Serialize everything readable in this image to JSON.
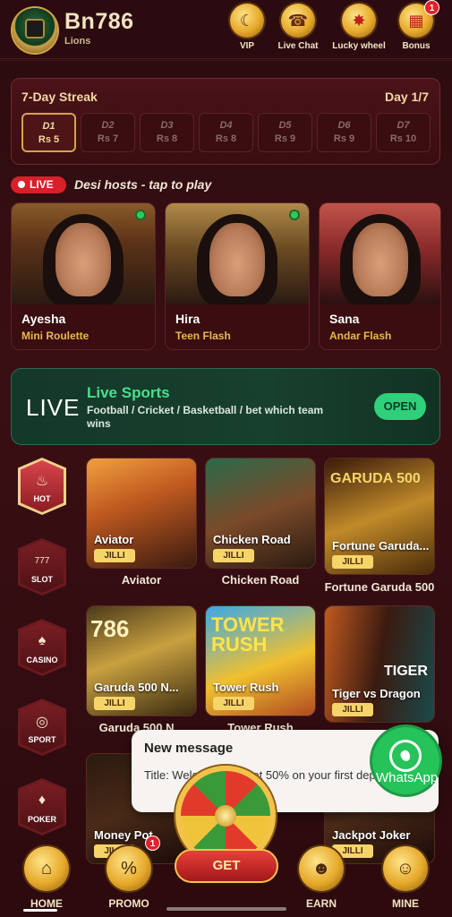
{
  "header": {
    "brand": "Bn786",
    "subtitle": "Lions",
    "buttons": [
      {
        "label": "VIP",
        "icon": "crescent-icon"
      },
      {
        "label": "Live Chat",
        "icon": "headset-icon"
      },
      {
        "label": "Lucky wheel",
        "icon": "wheel-icon"
      },
      {
        "label": "Bonus",
        "icon": "gift-icon",
        "badge": "1"
      }
    ]
  },
  "streak": {
    "title": "7-Day Streak",
    "day": "Day 1/7",
    "days": [
      {
        "d": "D1",
        "reward": "Rs 5"
      },
      {
        "d": "D2",
        "reward": "Rs 7"
      },
      {
        "d": "D3",
        "reward": "Rs 8"
      },
      {
        "d": "D4",
        "reward": "Rs 8"
      },
      {
        "d": "D5",
        "reward": "Rs 9"
      },
      {
        "d": "D6",
        "reward": "Rs 9"
      },
      {
        "d": "D7",
        "reward": "Rs 10"
      }
    ],
    "active_index": 0
  },
  "live": {
    "pill": "LIVE",
    "hint": "Desi hosts - tap to play",
    "hosts": [
      {
        "name": "Ayesha",
        "game": "Mini Roulette",
        "online": true
      },
      {
        "name": "Hira",
        "game": "Teen Flash",
        "online": true
      },
      {
        "name": "Sana",
        "game": "Andar Flash",
        "online": false
      }
    ]
  },
  "sports": {
    "live": "LIVE",
    "title": "Live Sports",
    "desc": "Football / Cricket / Basketball / bet which team wins",
    "open": "OPEN"
  },
  "categories": [
    {
      "label": "HOT",
      "icon": "flame-icon",
      "glyph": "♨"
    },
    {
      "label": "SLOT",
      "icon": "slot-icon",
      "glyph": "777"
    },
    {
      "label": "CASINO",
      "icon": "cards-icon",
      "glyph": "♠"
    },
    {
      "label": "SPORT",
      "icon": "globe-icon",
      "glyph": "◎"
    },
    {
      "label": "POKER",
      "icon": "poker-icon",
      "glyph": "♦"
    }
  ],
  "games": [
    {
      "title": "Aviator",
      "tag": "JILLI",
      "caption": "Aviator"
    },
    {
      "title": "Chicken Road",
      "tag": "JILLI",
      "caption": "Chicken Road"
    },
    {
      "title": "Fortune Garuda...",
      "tag": "JILLI",
      "caption": "Fortune Garuda 500",
      "art": "GARUDA 500"
    },
    {
      "title": "Garuda 500 N...",
      "tag": "JILLI",
      "caption": "Garuda 500 N...",
      "art": "786"
    },
    {
      "title": "Tower Rush",
      "tag": "JILLI",
      "caption": "Tower Rush",
      "art": "TOWER RUSH"
    },
    {
      "title": "Tiger vs Dragon",
      "tag": "JILLI",
      "caption": "Tiger vs Dragon",
      "art": "TIGER"
    },
    {
      "title": "Money Pot",
      "tag": "JILLI",
      "caption": "Money Pot"
    },
    {
      "title": "Jackpot Joker",
      "tag": "JILLI",
      "caption": "Jackpot Joker"
    }
  ],
  "notice": {
    "title": "New message",
    "body": "Title: Welcome You get 50% on your first deposit"
  },
  "whatsapp": {
    "label": "WhatsApp"
  },
  "wheel": {
    "button": "GET"
  },
  "nav": [
    {
      "label": "HOME",
      "icon": "home-icon"
    },
    {
      "label": "PROMO",
      "icon": "percent-icon",
      "badge": "1"
    },
    {
      "label": "EARN",
      "icon": "earn-icon"
    },
    {
      "label": "MINE",
      "icon": "user-icon"
    }
  ],
  "colors": {
    "background": "#3a0f14",
    "gold": "#e6a92a",
    "live_red": "#d8202a",
    "sports_green": "#2fd07a",
    "tag_yellow": "#f5d56a"
  }
}
